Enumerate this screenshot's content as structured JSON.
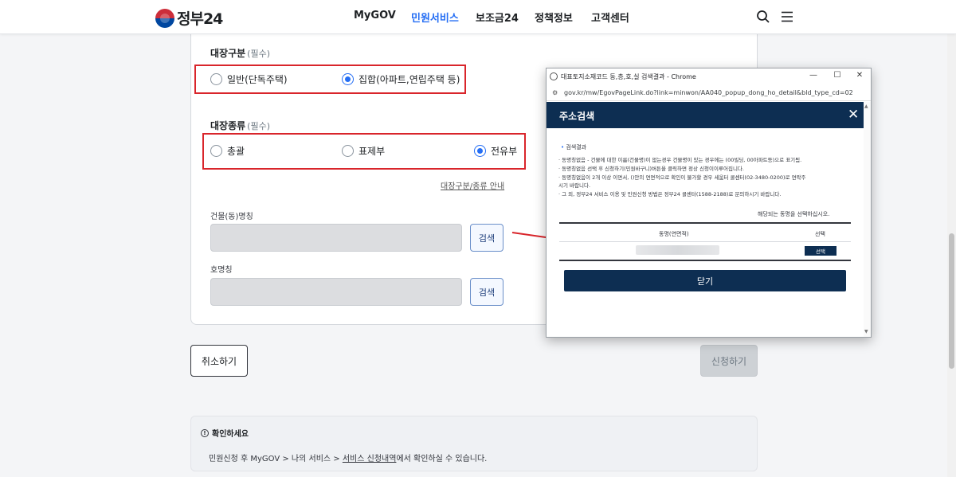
{
  "header": {
    "logo_text": "정부24",
    "nav": [
      "MyGOV",
      "민원서비스",
      "보조금24",
      "정책정보",
      "고객센터"
    ],
    "active_nav": "민원서비스",
    "icons": [
      "search-icon",
      "menu-icon"
    ]
  },
  "form": {
    "ledger_type": {
      "label": "대장구분",
      "required": "(필수)",
      "options": [
        "일반(단독주택)",
        "집합(아파트,연립주택 등)"
      ],
      "selected": "집합(아파트,연립주택 등)"
    },
    "ledger_kind": {
      "label": "대장종류",
      "required": "(필수)",
      "options": [
        "총괄",
        "표제부",
        "전유부"
      ],
      "selected": "전유부"
    },
    "guide_link": "대장구분/종류 안내",
    "building_name": {
      "label": "건물(동)명칭",
      "value": "",
      "search": "검색"
    },
    "unit_name": {
      "label": "호명칭",
      "value": "",
      "search": "검색"
    },
    "cancel_label": "취소하기",
    "submit_label": "신청하기"
  },
  "notice": {
    "title": "확인하세요",
    "text_prefix": "민원신청 후 MyGOV > 나의 서비스 > ",
    "text_link": "서비스 신청내역",
    "text_suffix": "에서 확인하실 수 있습니다."
  },
  "popup": {
    "window_title": "대표토지소재코드 동,층,호,실 검색결과 - Chrome",
    "url": "gov.kr/mw/EgovPageLink.do?link=minwon/AA040_popup_dong_ho_detail&bld_type_cd=02",
    "header_title": "주소검색",
    "result_title": "검색결과",
    "lines": [
      "· 동명칭없음 - 건물에 대한 이름(건물명)이 없는경우 건물명이 있는 경우에는 (00빌딩, 00아파트등)으로 표기됨.",
      "· 동명칭없음 선택 후 신청하기(민원바구니)버튼을 클릭하면 정상 신청이이루어집니다.",
      "· 동명칭없음이 2개 이상 이면서, ()안의 연면적으로 확인이 불가할 경우 세움터 콜센터(02-3480-0200)로 연락주",
      "  시기 바랍니다.",
      "· 그 외, 정부24 서비스 이용 및 민원신청 방법은 정부24 콜센터(1588-2188)로 문의하시기 바랍니다."
    ],
    "right_note": "해당되는 동명을 선택하십시오.",
    "columns": [
      "동명(연면적)",
      "선택"
    ],
    "select_label": "선택",
    "close_label": "닫기"
  }
}
